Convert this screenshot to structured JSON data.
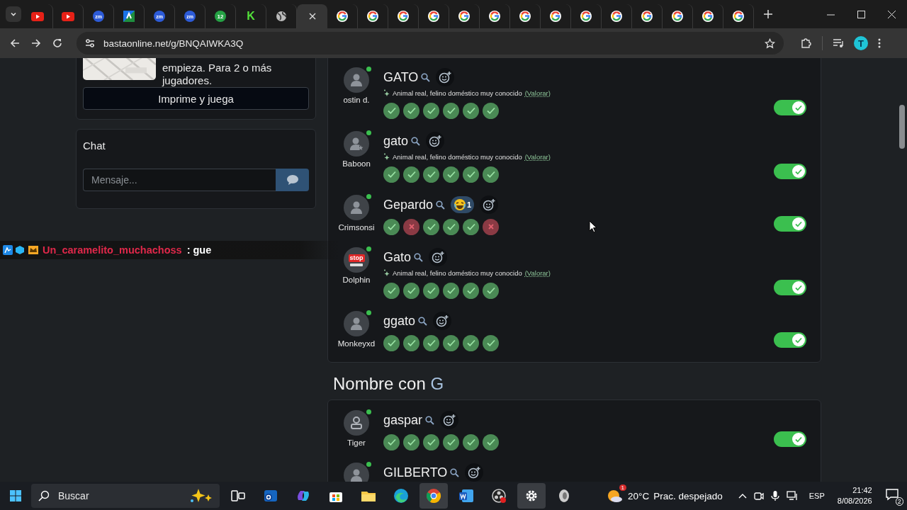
{
  "browser": {
    "tabs": [
      {
        "kind": "youtube",
        "selected": false
      },
      {
        "kind": "youtube",
        "selected": false
      },
      {
        "kind": "zoom",
        "label": "zm",
        "selected": false
      },
      {
        "kind": "app",
        "selected": false
      },
      {
        "kind": "zoom",
        "label": "zm",
        "selected": false
      },
      {
        "kind": "zoom",
        "label": "zm",
        "selected": false
      },
      {
        "kind": "chat",
        "label": "12",
        "selected": false
      },
      {
        "kind": "k",
        "label": "K",
        "selected": false
      },
      {
        "kind": "globe",
        "selected": false
      },
      {
        "selected": true
      },
      {
        "kind": "google",
        "selected": false
      },
      {
        "kind": "google",
        "selected": false
      },
      {
        "kind": "google",
        "selected": false
      },
      {
        "kind": "google",
        "selected": false
      },
      {
        "kind": "google",
        "selected": false
      },
      {
        "kind": "google",
        "selected": false
      },
      {
        "kind": "google",
        "selected": false
      },
      {
        "kind": "google",
        "selected": false
      },
      {
        "kind": "google",
        "selected": false
      },
      {
        "kind": "google",
        "selected": false
      },
      {
        "kind": "google",
        "selected": false
      },
      {
        "kind": "google",
        "selected": false
      },
      {
        "kind": "google",
        "selected": false
      },
      {
        "kind": "google",
        "selected": false
      }
    ],
    "address": "bastaonline.net/g/BNQAIWKA3Q",
    "profile": "T"
  },
  "sidebar": {
    "intro_text": "empieza. Para 2 o más jugadores.",
    "print_button": "Imprime y juega",
    "chat": {
      "title": "Chat",
      "placeholder": "Mensaje..."
    }
  },
  "stream_chat": {
    "user": "Un_caramelito_muchachoss",
    "separator": ":",
    "message": "gue"
  },
  "answers": {
    "rows": [
      {
        "player": "ostin d.",
        "avatar": {
          "kind": "person"
        },
        "online": true,
        "word": "GATO",
        "note": "Animal real, felino doméstico muy conocido",
        "note_link": "(Valorar)",
        "votes": [
          {
            "valid": true
          },
          {
            "valid": true
          },
          {
            "valid": true
          },
          {
            "valid": true
          },
          {
            "valid": true
          },
          {
            "valid": true
          }
        ],
        "on": true
      },
      {
        "player": "Baboon",
        "avatar": {
          "kind": "person-star"
        },
        "online": true,
        "word": "gato",
        "note": "Animal real, felino doméstico muy conocido",
        "note_link": "(Valorar)",
        "votes": [
          {
            "valid": true
          },
          {
            "valid": true
          },
          {
            "valid": true
          },
          {
            "valid": true
          },
          {
            "valid": true
          },
          {
            "valid": true
          }
        ],
        "on": true
      },
      {
        "player": "Crimsonsi",
        "avatar": {
          "kind": "person"
        },
        "online": true,
        "word": "Gepardo",
        "reaction": {
          "count": "1"
        },
        "votes": [
          {
            "valid": true
          },
          {
            "valid": false
          },
          {
            "valid": true
          },
          {
            "valid": true
          },
          {
            "valid": true
          },
          {
            "valid": false
          }
        ],
        "on": true
      },
      {
        "player": "Dolphin",
        "avatar": {
          "kind": "stop",
          "label": "stop"
        },
        "online": true,
        "word": "Gato",
        "note": "Animal real, felino doméstico muy conocido",
        "note_link": "(Valorar)",
        "votes": [
          {
            "valid": true
          },
          {
            "valid": true
          },
          {
            "valid": true
          },
          {
            "valid": true
          },
          {
            "valid": true
          },
          {
            "valid": true
          }
        ],
        "on": true
      },
      {
        "player": "Monkeyxd",
        "avatar": {
          "kind": "person"
        },
        "online": true,
        "word": "ggato",
        "votes": [
          {
            "valid": true
          },
          {
            "valid": true
          },
          {
            "valid": true
          },
          {
            "valid": true
          },
          {
            "valid": true
          },
          {
            "valid": true
          }
        ],
        "on": true
      }
    ]
  },
  "section": {
    "title": "Nombre con",
    "letter": "G",
    "rows": [
      {
        "player": "Tiger",
        "avatar": {
          "kind": "person-badge"
        },
        "online": true,
        "word": "gaspar",
        "votes": [
          {
            "valid": true
          },
          {
            "valid": true
          },
          {
            "valid": true
          },
          {
            "valid": true
          },
          {
            "valid": true
          },
          {
            "valid": true
          }
        ],
        "on": true
      },
      {
        "avatar": {
          "kind": "person"
        },
        "online": true,
        "word": "GILBERTO"
      }
    ]
  },
  "taskbar": {
    "search_placeholder": "Buscar",
    "apps": [
      {
        "kind": "taskview",
        "selected": false
      },
      {
        "kind": "mail",
        "selected": false
      },
      {
        "kind": "copilot",
        "selected": false
      },
      {
        "kind": "store",
        "selected": false
      },
      {
        "kind": "folder",
        "selected": false
      },
      {
        "kind": "edge",
        "selected": false
      },
      {
        "kind": "chrome",
        "selected": true
      },
      {
        "kind": "word",
        "selected": false
      },
      {
        "kind": "record",
        "selected": false
      },
      {
        "kind": "settings",
        "selected": true
      },
      {
        "kind": "disc",
        "selected": false
      }
    ],
    "weather": {
      "alert": "1",
      "temp": "20°C",
      "condition": "Prac. despejado"
    },
    "language": "ESP",
    "time": "21:42",
    "date": "8/08/2026",
    "notifications": "2"
  }
}
